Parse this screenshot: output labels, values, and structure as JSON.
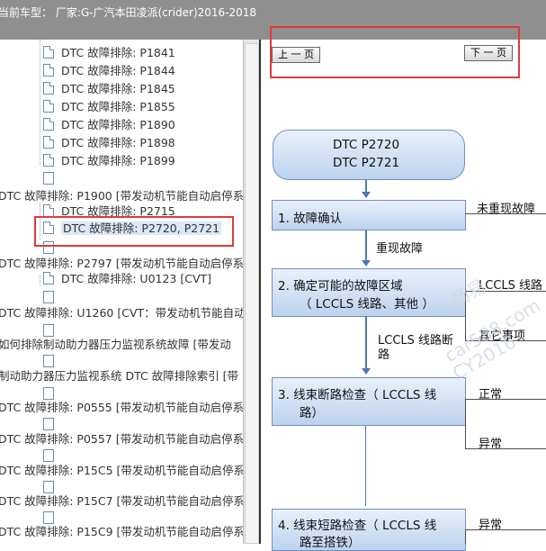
{
  "title_bar": {
    "text": "当前车型： 厂家:G-广汽本田凌派(crider)2016-2018"
  },
  "tree": {
    "items": [
      "DTC 故障排除: P1841",
      "DTC 故障排除: P1844",
      "DTC 故障排除: P1845",
      "DTC 故障排除: P1855",
      "DTC 故障排除: P1890",
      "DTC 故障排除: P1898",
      "DTC 故障排除: P1899",
      "DTC 故障排除: P1900 [带发动机节能自动启停系",
      "DTC 故障排除: P2715",
      "DTC 故障排除: P2720, P2721",
      "DTC 故障排除: P2797 [带发动机节能自动启停系",
      "DTC 故障排除: U0123 [CVT]",
      "DTC 故障排除: U1260 [CVT：带发动机节能自动",
      "如何排除制动助力器压力监视系统故障 [带发动",
      "制动助力器压力监视系统 DTC 故障排除索引 [带",
      "DTC 故障排除: P0555 [带发动机节能自动启停系",
      "DTC 故障排除: P0557 [带发动机节能自动启停系",
      "DTC 故障排除: P15C5 [带发动机节能自动启停系",
      "DTC 故障排除: P15C7 [带发动机节能自动启停系",
      "DTC 故障排除: P15C9 [带发动机节能自动启停系"
    ]
  },
  "toolbar": {
    "prev_label": "上 一 页",
    "next_label": "下 一 页"
  },
  "flowchart": {
    "start_line1": "DTC P2720",
    "start_line2": "DTC P2721",
    "step1": "1.  故障确认",
    "step1_right": "未重现故障",
    "step1_down": "重现故障",
    "step2_line1": "2.  确定可能的故障区域",
    "step2_line2": "（ LCCLS 线路、其他 ）",
    "step2_right1": "LCCLS 线路",
    "step2_right2": "其它事项",
    "step2_down_line1": "LCCLS 线路断",
    "step2_down_line2": "路",
    "step3_line1": "3.  线束断路检查（ LCCLS 线",
    "step3_line2": "路）",
    "step3_right1": "正常",
    "step3_right2": "异常",
    "step4_line1": "4.  线束短路检查（ LCCLS 线",
    "step4_line2": "路至搭铁）",
    "step4_right1": "异常"
  },
  "watermark": {
    "line1": "畅易",
    "line2": "car588.com",
    "line3": "CY2016"
  }
}
